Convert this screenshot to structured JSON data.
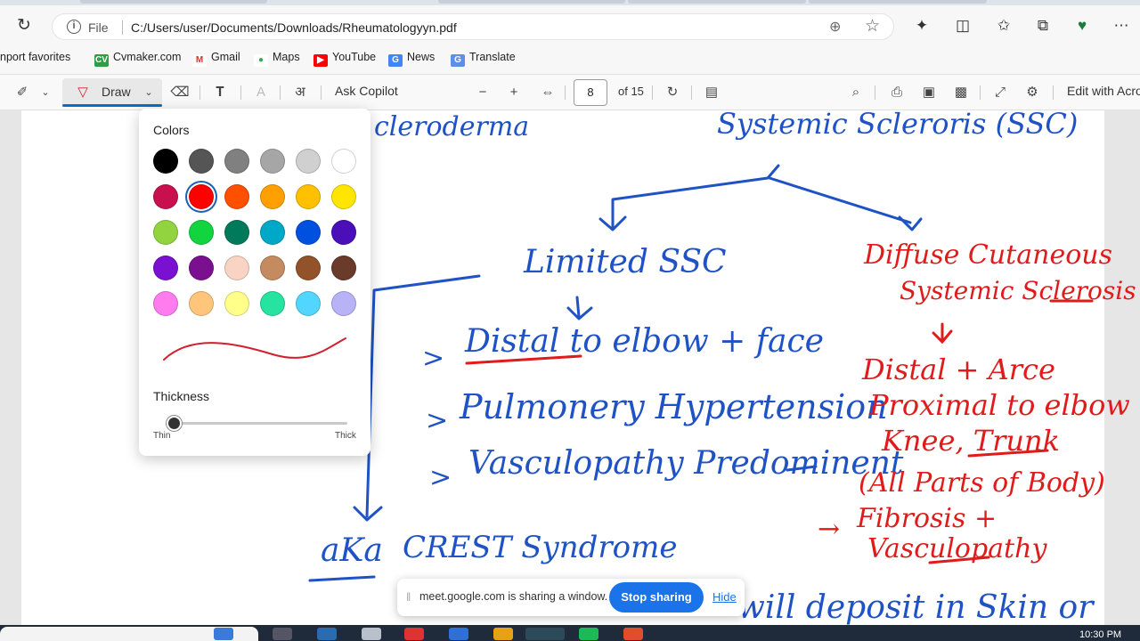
{
  "browser": {
    "address": {
      "scheme_label": "File",
      "url": "C:/Users/user/Documents/Downloads/Rheumatologyyn.pdf"
    },
    "icons": [
      "refresh-icon",
      "info-icon",
      "zoom-icon",
      "favorite-star-icon",
      "extensions-icon",
      "split-screen-icon",
      "favorites-icon",
      "collections-icon",
      "browser-essentials-icon",
      "more-icon"
    ]
  },
  "bookmarks": [
    {
      "label": "nport favorites",
      "icon": "import-icon"
    },
    {
      "label": "Cvmaker.com",
      "icon": "cv-icon",
      "badge": "CV",
      "color": "#2e9e44"
    },
    {
      "label": "Gmail",
      "icon": "gmail-icon",
      "badge": "M",
      "color": "#d93025"
    },
    {
      "label": "Maps",
      "icon": "maps-icon",
      "badge": "●",
      "color": "#34a853"
    },
    {
      "label": "YouTube",
      "icon": "youtube-icon",
      "badge": "▶",
      "color": "#ff0000"
    },
    {
      "label": "News",
      "icon": "news-icon",
      "badge": "G",
      "color": "#4285f4"
    },
    {
      "label": "Translate",
      "icon": "translate-icon",
      "badge": "G",
      "color": "#5f8de8"
    }
  ],
  "pdf_toolbar": {
    "draw_label": "Draw",
    "ask_copilot_label": "Ask Copilot",
    "page_current": "8",
    "page_total": "of 15",
    "edit_label": "Edit with Acro"
  },
  "draw_panel": {
    "colors_title": "Colors",
    "colors": [
      "#000000",
      "#555555",
      "#808080",
      "#a6a6a6",
      "#d0d0d0",
      "#ffffff",
      "#c8104f",
      "#ff0000",
      "#ff4f00",
      "#ff9f00",
      "#ffc000",
      "#ffe500",
      "#92d43f",
      "#11d43f",
      "#007a5a",
      "#00a8c8",
      "#0050e0",
      "#4a0fb8",
      "#7a10d0",
      "#7a1090",
      "#f9d3c3",
      "#c48a60",
      "#92522a",
      "#6a3a2a",
      "#ff7cef",
      "#ffc57a",
      "#ffff8a",
      "#27e3a0",
      "#52d6ff",
      "#b8b2f7"
    ],
    "selected_color": "#ff0000",
    "thickness_title": "Thickness",
    "thickness_min_label": "Thin",
    "thickness_max_label": "Thick",
    "thickness_value": 0.03
  },
  "notes": {
    "title_left": "cleroderma",
    "title_right": "Systemic Scleroris (SSC)",
    "limited": "Limited SSC",
    "diffuse_1": "Diffuse Cutaneous",
    "diffuse_2": "Systemic Sclerosis",
    "bullet_1": "Distal to elbow + face",
    "bullet_2": "Pulmonery Hypertension",
    "bullet_3": "Vasculopathy Predominent",
    "right_1": "Distal + Arce",
    "right_2": "Proximal to elbow",
    "right_3": "Knee, Trunk",
    "right_4": "(All Parts of Body)",
    "right_5": "Fibrosis +",
    "right_6": "Vasculopathy",
    "aka": "aKa",
    "crest": "CREST Syndrome",
    "bottom": "will deposit in Skin or",
    "bullet_mark": ">",
    "arrow_mark": "→"
  },
  "share_bar": {
    "message": "meet.google.com is sharing a window.",
    "stop_label": "Stop sharing",
    "hide_label": "Hide"
  },
  "taskbar": {
    "clock": "10:30 PM"
  }
}
